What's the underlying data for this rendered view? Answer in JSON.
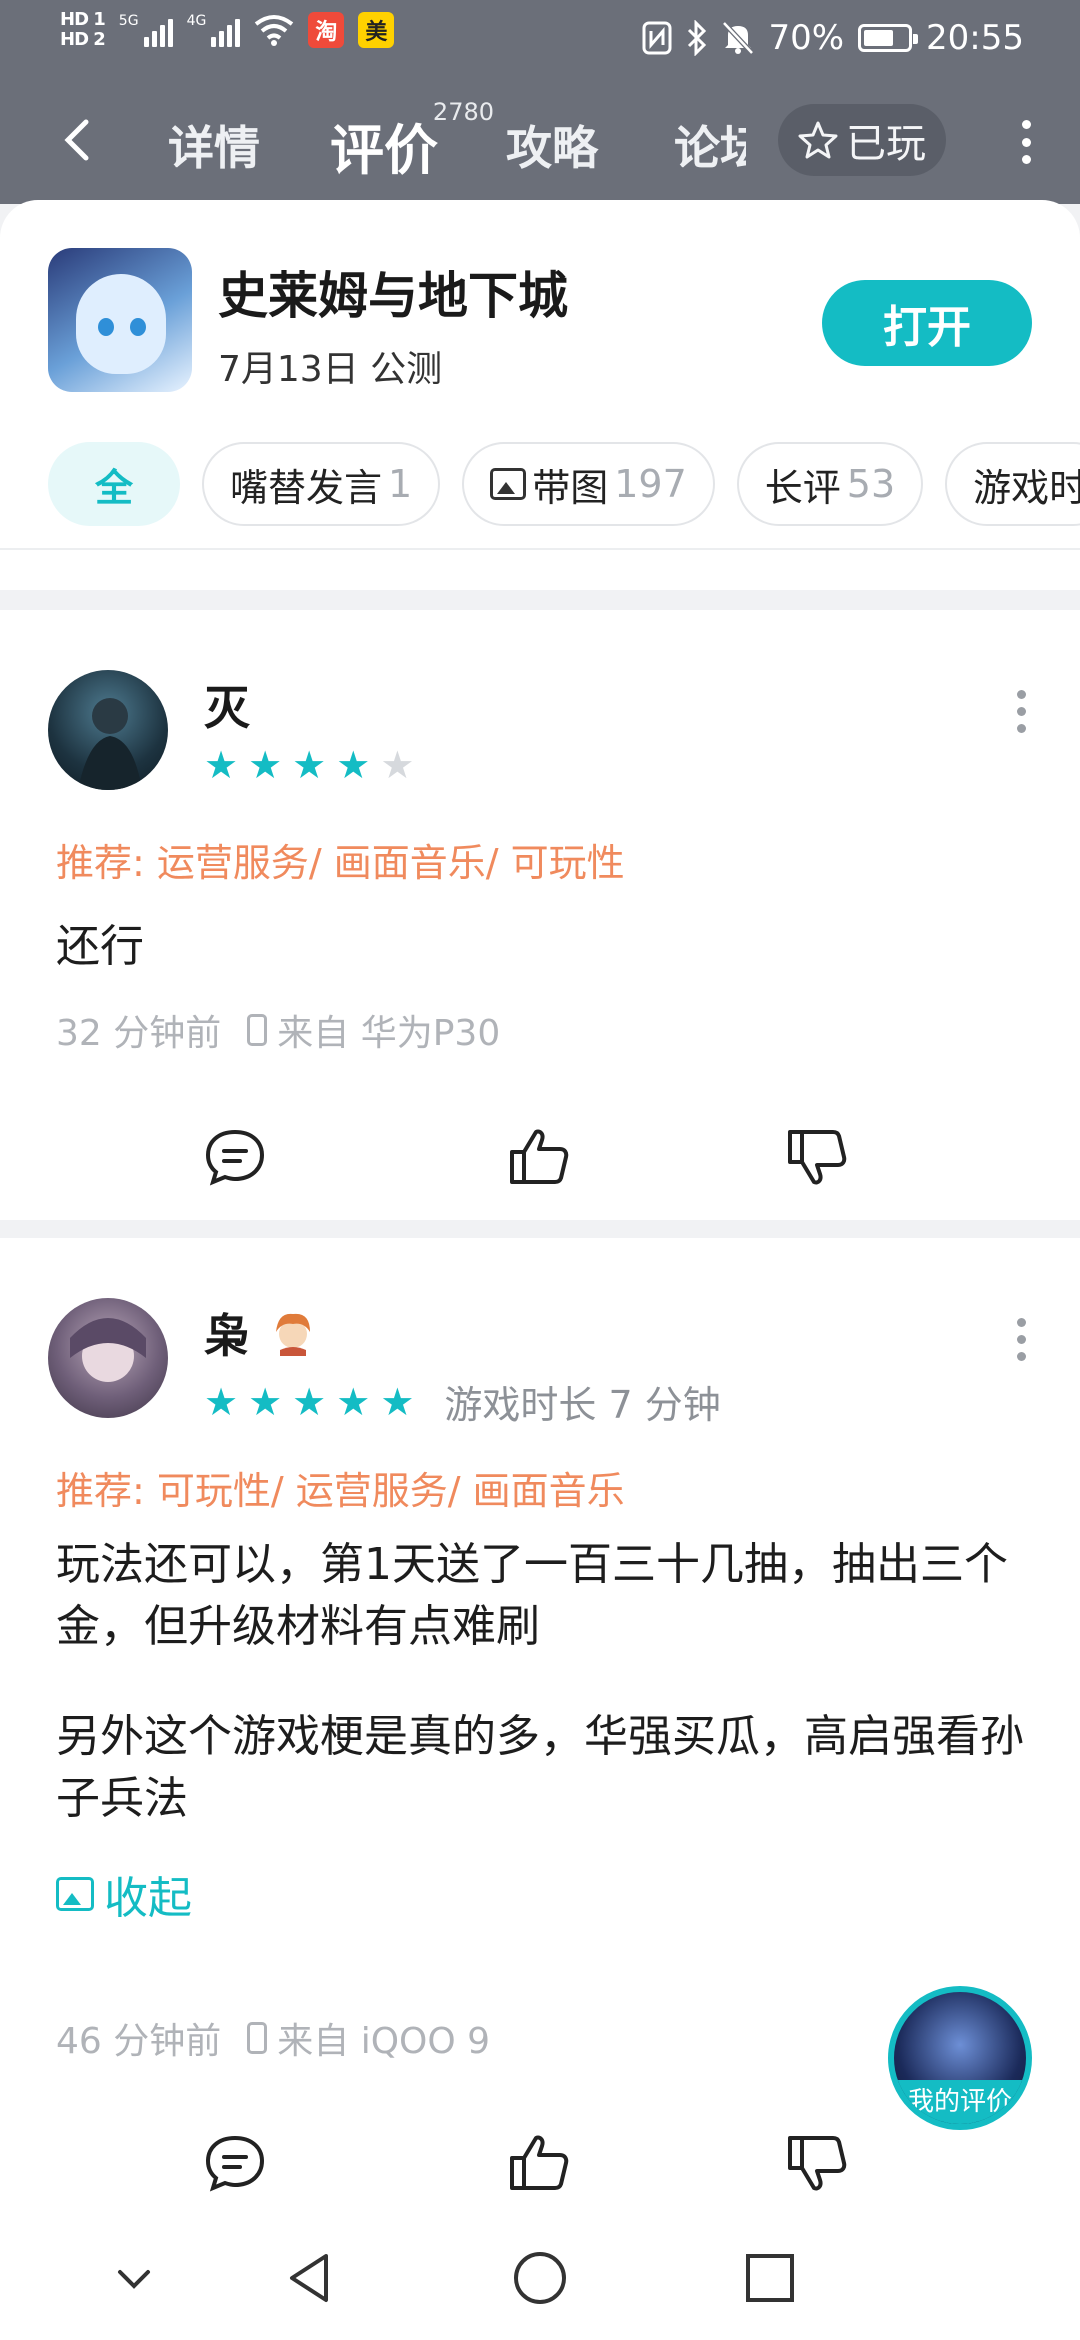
{
  "status": {
    "hd1": "HD 1",
    "hd2": "HD 2",
    "net1": "5G",
    "net2": "4G",
    "app_badge_taobao": "淘",
    "app_badge_meituan": "美",
    "battery": "70%",
    "time": "20:55",
    "icons": [
      "nfc-icon",
      "bluetooth-icon",
      "mute-icon",
      "battery-icon"
    ]
  },
  "nav": {
    "tabs": [
      {
        "label": "详情"
      },
      {
        "label": "评价",
        "count": "2780"
      },
      {
        "label": "攻略"
      },
      {
        "label": "论坛"
      }
    ],
    "played_label": "已玩"
  },
  "app": {
    "name": "史莱姆与地下城",
    "date": "7月13日 公测",
    "open_label": "打开"
  },
  "filters": [
    {
      "label": "全",
      "count": ""
    },
    {
      "label": "嘴替发言",
      "count": "1"
    },
    {
      "label": "带图",
      "count": "197"
    },
    {
      "label": "长评",
      "count": "53"
    },
    {
      "label": "游戏时",
      "count": ""
    }
  ],
  "reviews": [
    {
      "user": "灭",
      "rating": 4,
      "playtime": "",
      "recommend": "推荐: 运营服务/ 画面音乐/ 可玩性",
      "paragraphs": [
        "还行"
      ],
      "time": "32 分钟前",
      "device": "来自 华为P30"
    },
    {
      "user": "枭",
      "rating": 5,
      "playtime": "游戏时长 7 分钟",
      "recommend": "推荐: 可玩性/ 运营服务/ 画面音乐",
      "paragraphs": [
        "玩法还可以，第1天送了一百三十几抽，抽出三个金，但升级材料有点难刷",
        "另外这个游戏梗是真的多，华强买瓜，高启强看孙子兵法"
      ],
      "collapse_label": "收起",
      "time": "46 分钟前",
      "device": "来自 iQOO 9"
    }
  ],
  "fab": {
    "label": "我的评价"
  },
  "colors": {
    "accent": "#14bcc4",
    "recommend": "#f08a5d",
    "header": "#6b6f79"
  }
}
